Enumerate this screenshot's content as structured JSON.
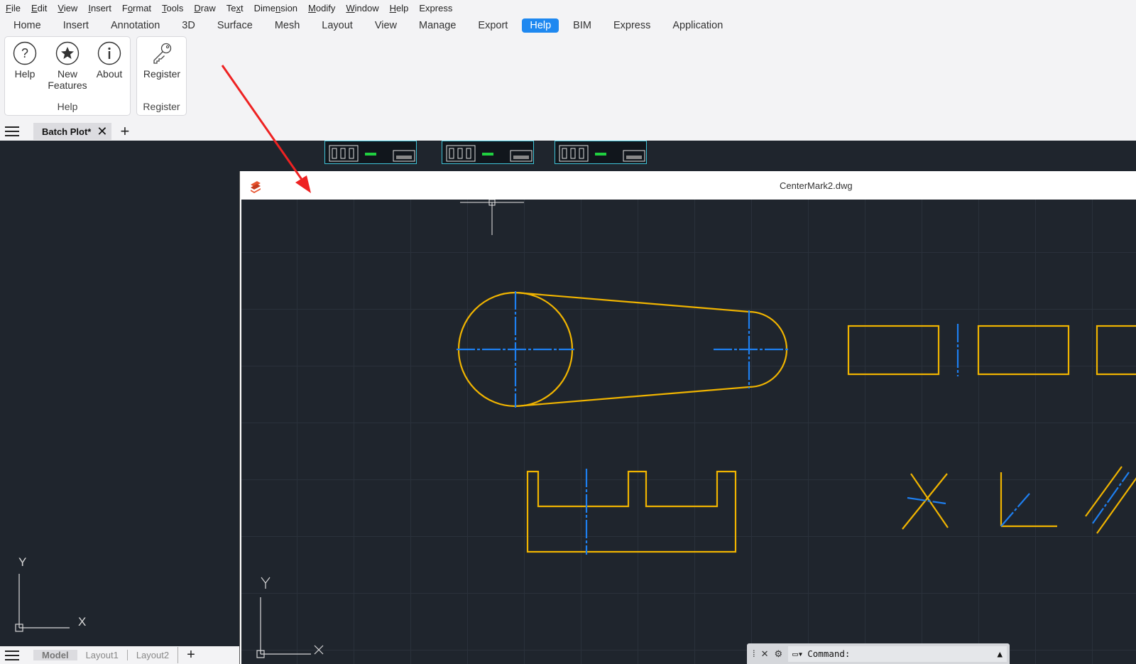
{
  "menu": {
    "items": [
      {
        "label": "File",
        "u": "F",
        "rest": "ile"
      },
      {
        "label": "Edit",
        "u": "E",
        "rest": "dit"
      },
      {
        "label": "View",
        "u": "V",
        "rest": "iew"
      },
      {
        "label": "Insert",
        "u": "I",
        "rest": "nsert"
      },
      {
        "label": "Format",
        "pre": "F",
        "u": "o",
        "rest": "rmat"
      },
      {
        "label": "Tools",
        "u": "T",
        "rest": "ools"
      },
      {
        "label": "Draw",
        "u": "D",
        "rest": "raw"
      },
      {
        "label": "Text",
        "pre": "Te",
        "u": "x",
        "rest": "t"
      },
      {
        "label": "Dimension",
        "pre": "Dime",
        "u": "n",
        "rest": "sion"
      },
      {
        "label": "Modify",
        "u": "M",
        "rest": "odify"
      },
      {
        "label": "Window",
        "u": "W",
        "rest": "indow"
      },
      {
        "label": "Help",
        "u": "H",
        "rest": "elp"
      },
      {
        "label": "Express",
        "u": "",
        "rest": "Express"
      }
    ]
  },
  "ribbon_tabs": [
    "Home",
    "Insert",
    "Annotation",
    "3D",
    "Surface",
    "Mesh",
    "Layout",
    "View",
    "Manage",
    "Export",
    "Help",
    "BIM",
    "Express",
    "Application"
  ],
  "ribbon_active": "Help",
  "help_panel": {
    "title": "Help",
    "buttons": [
      {
        "label": "Help",
        "icon": "question-circle-icon"
      },
      {
        "label": "New\nFeatures",
        "line1": "New",
        "line2": "Features",
        "icon": "star-circle-icon"
      },
      {
        "label": "About",
        "icon": "info-circle-icon"
      }
    ]
  },
  "register_panel": {
    "title": "Register",
    "button": {
      "label": "Register",
      "icon": "key-icon"
    }
  },
  "doc_tab": {
    "label": "Batch Plot*"
  },
  "drawing_window": {
    "title": "CenterMark2.dwg"
  },
  "layout_tabs": [
    "Model",
    "Layout1",
    "Layout2"
  ],
  "command": {
    "prompt": "Command:"
  },
  "ucs": {
    "x_label": "X",
    "y_label": "Y"
  },
  "colors": {
    "accent": "#1e88f0",
    "canvas": "#1f252d",
    "geometry": "#f0b400",
    "centerline": "#1e7ff0",
    "arrow": "#ee2222"
  }
}
